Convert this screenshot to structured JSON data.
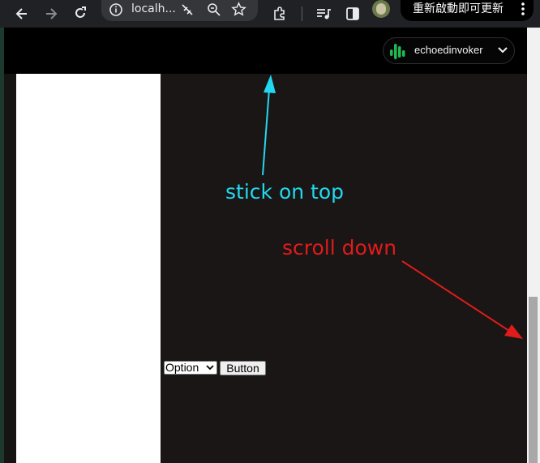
{
  "browser": {
    "url": "localh...",
    "update_button": "重新啟動即可更新",
    "icons": [
      "back-icon",
      "forward-icon",
      "reload-icon",
      "site-info-icon",
      "no-translate-icon",
      "zoom-icon",
      "bookmark-star-icon",
      "extensions-icon",
      "media-icon",
      "side-panel-icon",
      "profile-avatar-icon",
      "more-menu-icon"
    ]
  },
  "header": {
    "username": "echoedinvoker",
    "logo_color": "#1db954"
  },
  "main": {
    "select_value": "Option",
    "button_label": "Button"
  },
  "annotations": {
    "stick_on_top": "stick on top",
    "scroll_down": "scroll down",
    "stick_color": "#22d8f0",
    "scroll_color": "#e01b1b"
  }
}
